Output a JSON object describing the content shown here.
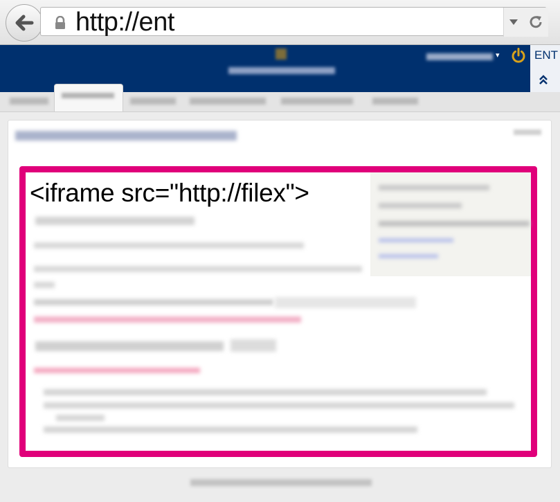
{
  "browser": {
    "url": "http://ent",
    "icons": {
      "back": "back-arrow-icon",
      "lock": "lock-icon",
      "dropdown": "dropdown-icon",
      "reload": "reload-icon"
    }
  },
  "site_header": {
    "ent_label": "ENT",
    "icons": {
      "power": "power-icon",
      "collapse": "double-chevron-up-icon"
    },
    "colors": {
      "header_bg": "#00306e",
      "power": "#d9a21b"
    }
  },
  "content": {
    "iframe_label": "<iframe src=\"http://filex\">",
    "highlight_color": "#e0007a"
  }
}
